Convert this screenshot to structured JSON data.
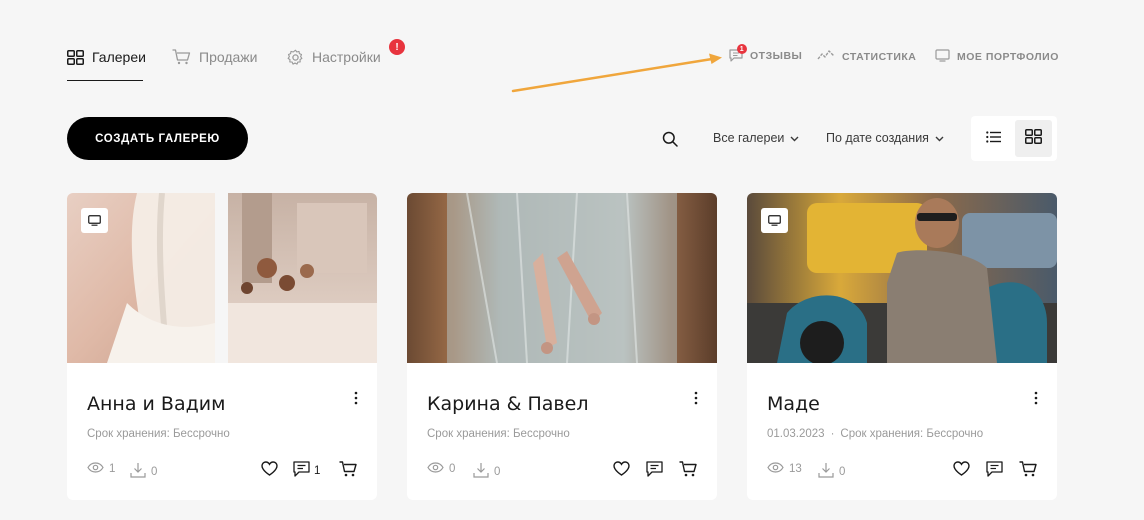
{
  "nav": {
    "tabs": [
      {
        "label": "Галереи",
        "icon": "grid-icon",
        "active": true
      },
      {
        "label": "Продажи",
        "icon": "cart-icon",
        "active": false
      },
      {
        "label": "Настройки",
        "icon": "gear-icon",
        "active": false,
        "badge": "!"
      }
    ],
    "links": [
      {
        "label": "ОТЗЫВЫ",
        "icon": "chat-icon",
        "badge": "1"
      },
      {
        "label": "СТАТИСТИКА",
        "icon": "chart-line-icon"
      },
      {
        "label": "МОЕ ПОРТФОЛИО",
        "icon": "monitor-icon"
      }
    ]
  },
  "toolbar": {
    "create_label": "СОЗДАТЬ ГАЛЕРЕЮ",
    "filter_label": "Все галереи",
    "sort_label": "По дате создания"
  },
  "galleries": [
    {
      "title": "Анна и Вадим",
      "meta_date": "",
      "meta_storage": "Срок хранения: Бессрочно",
      "views": "1",
      "downloads": "0",
      "comments": "1"
    },
    {
      "title": "Карина & Павел",
      "meta_date": "",
      "meta_storage": "Срок хранения: Бессрочно",
      "views": "0",
      "downloads": "0",
      "comments": ""
    },
    {
      "title": "Маде",
      "meta_date": "01.03.2023",
      "meta_separator": "·",
      "meta_storage": "Срок хранения: Бессрочно",
      "views": "13",
      "downloads": "0",
      "comments": ""
    }
  ],
  "colors": {
    "accent": "#000000",
    "badge": "#e8343e",
    "arrow": "#f0a63c",
    "background": "#f6f6f6"
  }
}
